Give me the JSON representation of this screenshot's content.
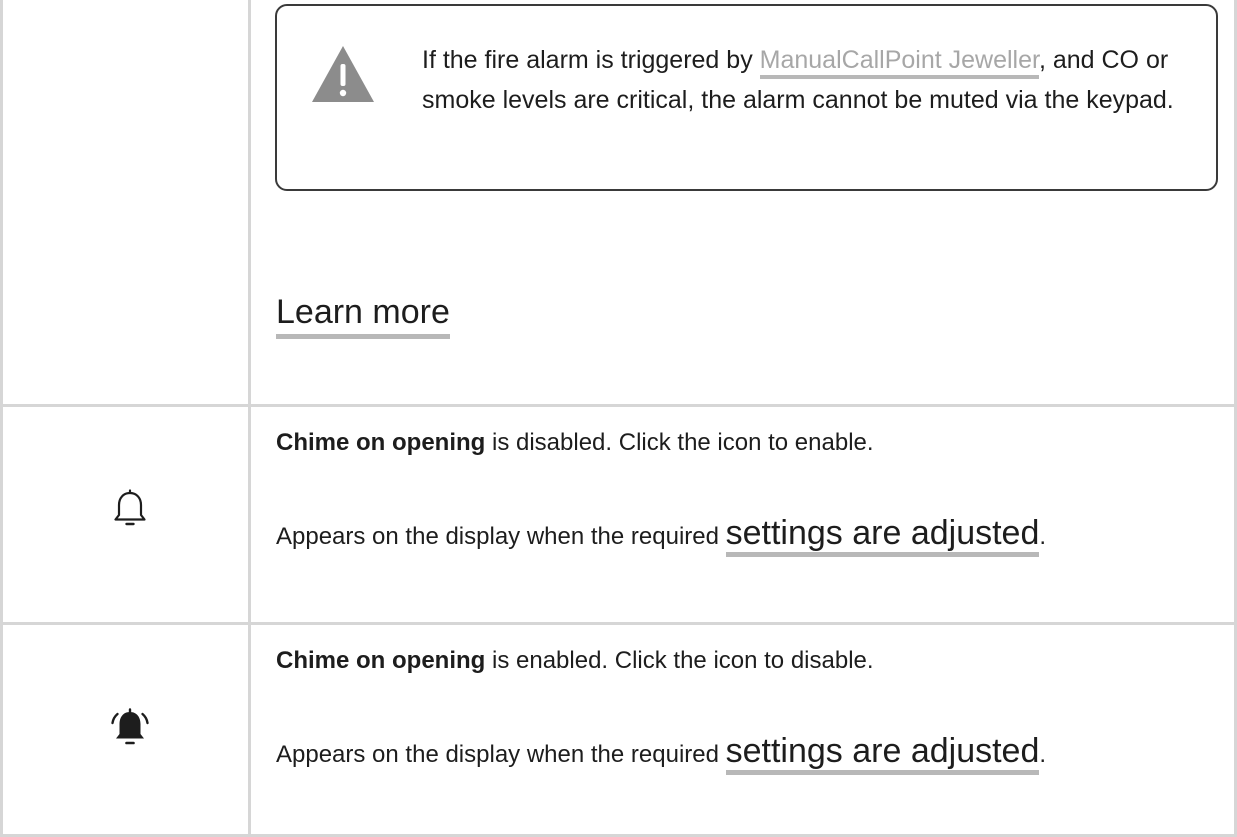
{
  "alert": {
    "icon": "warning-icon",
    "text_before": "If the fire alarm is triggered by ",
    "link_text": "ManualCallPoint Jeweller",
    "text_after": ", and CO or smoke levels are critical, the alarm cannot be muted via the keypad.",
    "link_color": "#a7a7a7"
  },
  "learn_more": {
    "label": "Learn more"
  },
  "rows": [
    {
      "icon": "bell-outline-icon",
      "title_strong": "Chime on opening",
      "title_rest": " is disabled. Click the icon to enable.",
      "desc_before": "Appears on the display when the required ",
      "desc_link": "settings are adjusted",
      "desc_after": "."
    },
    {
      "icon": "bell-ringing-icon",
      "title_strong": "Chime on opening",
      "title_rest": " is enabled. Click the icon to disable.",
      "desc_before": "Appears on the display when the required ",
      "desc_link": "settings are adjusted",
      "desc_after": "."
    }
  ],
  "colors": {
    "border": "#d6d6d6",
    "text": "#1d1d1d",
    "underline": "#b8b8b8",
    "warning_icon": "#8c8c8c"
  }
}
